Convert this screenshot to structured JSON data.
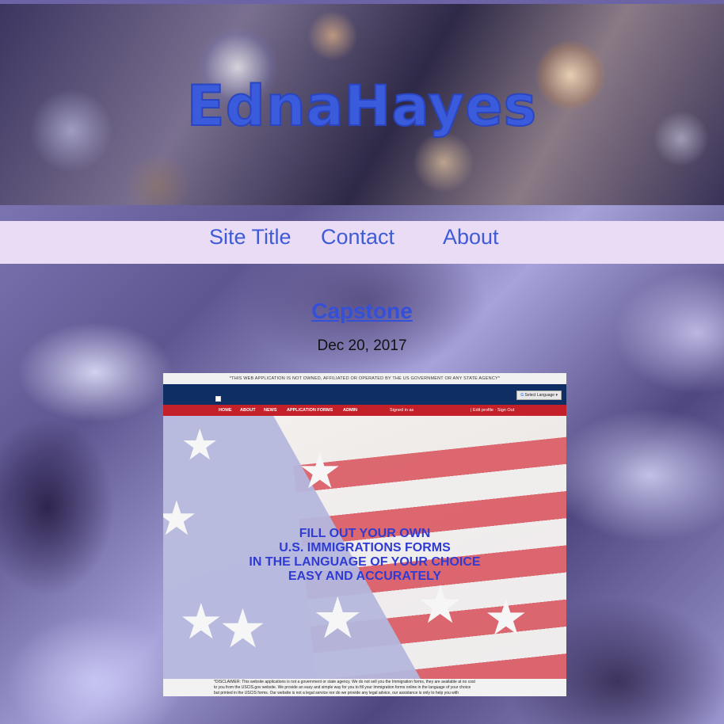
{
  "site": {
    "name": "EdnaHayes"
  },
  "nav": {
    "items": [
      {
        "label": "Site Title"
      },
      {
        "label": "Contact"
      },
      {
        "label": "About"
      }
    ]
  },
  "post": {
    "title": "Capstone",
    "date": "Dec 20, 2017"
  },
  "screenshot": {
    "notice": "*THIS WEB APPLICATION IS NOT OWNED, AFFILIATED OR OPERATED BY THE US GOVERNMENT OR ANY STATE AGENCY*",
    "language_button": "Select Language",
    "nav_items": [
      "HOME",
      "ABOUT",
      "NEWS",
      "APPLICATION FORMS",
      "ADMIN"
    ],
    "signed_in": "Signed in as",
    "profile_links": "| Edit profile · Sign Out",
    "hero_lines": [
      "FILL OUT YOUR OWN",
      "U.S. IMMIGRATIONS FORMS",
      "IN THE LANGUAGE OF YOUR CHOICE",
      "EASY AND ACCURATELY"
    ],
    "disclaimer_lines": [
      "*DISCLAIMER: This website applications is not a government or state agency. We do not sell you the Immigration forms, they are available at no cost",
      "to you from the USCIS.gov website. We provide an easy and simple way for you to fill your Immigration forms online in the language of your choice",
      "but printed in the USCIS forms. Our website is not a legal service nor do we provide any legal advice, our assistance is only to help you with"
    ]
  },
  "colors": {
    "accent": "#3f5bd6",
    "nav_background": "#e9dcf4",
    "title": "#3550d8"
  }
}
